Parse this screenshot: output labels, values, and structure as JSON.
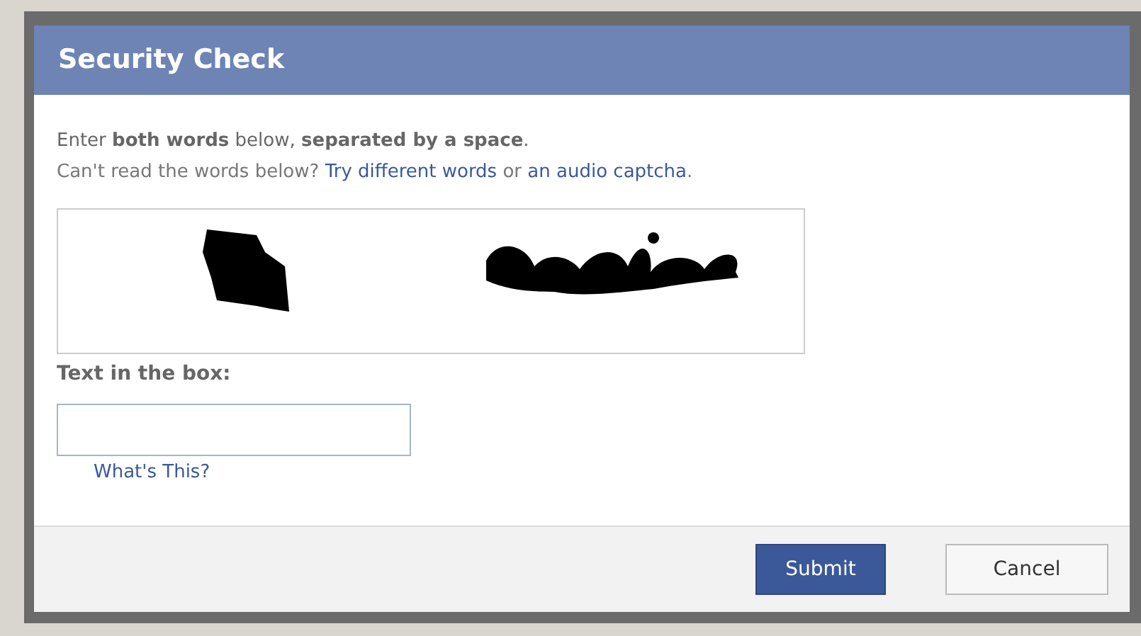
{
  "dialog": {
    "title": "Security Check",
    "instruction": "Enter **both words** below, **separated by a space**.",
    "help": [
      {
        "kind": "text",
        "text": "Can't read the words below? "
      },
      {
        "kind": "link",
        "text": "Try different words"
      },
      {
        "kind": "text",
        "text": " or "
      },
      {
        "kind": "link",
        "text": "an audio captcha"
      },
      {
        "kind": "text",
        "text": "."
      }
    ],
    "field_label": "Text in the box:",
    "help_link": "What's This?",
    "buttons": [
      {
        "label": "Submit",
        "kind": "primary"
      },
      {
        "label": "Cancel",
        "kind": "secondary"
      }
    ]
  }
}
